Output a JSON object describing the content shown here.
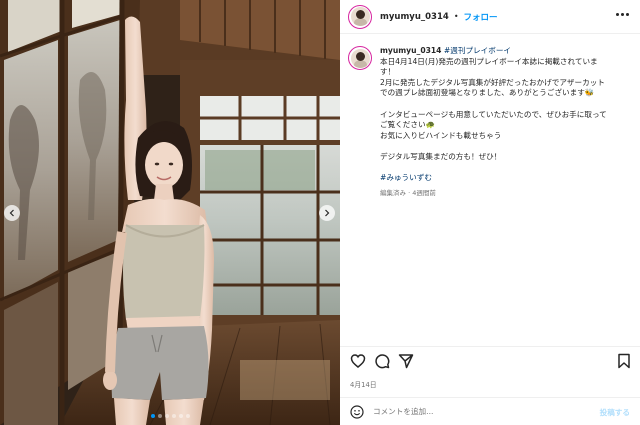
{
  "post": {
    "username": "myumyu_0314",
    "separator": "•",
    "follow_label": "フォロー",
    "photo_count": 6,
    "active_photo": 1
  },
  "caption": {
    "username": "myumyu_0314",
    "tag": "#週刊プレイボーイ",
    "lines": [
      "本日4月14日(月)発売の週刊プレイボーイ本誌に掲載されていま",
      "す！",
      "2月に発売したデジタル写真集が好評だったおかげでアザーカット",
      "での週プレ誌面初登場となりました、ありがとうございます🐝"
    ],
    "lines2": [
      "インタビューページも用意していただいたので、ぜひお手に取って",
      "ご覧ください🐢",
      "お気に入りビハインドも載せちゃう"
    ],
    "line3": "デジタル写真集まだの方も！ぜひ！",
    "hashtag": "#みゅういずむ",
    "meta": "編集済み · 4週間前"
  },
  "actions": {
    "like_icon": "heart-icon",
    "comment_icon": "comment-icon",
    "share_icon": "share-icon",
    "save_icon": "bookmark-icon"
  },
  "date": "4月14日",
  "comment": {
    "placeholder": "コメントを追加...",
    "post_label": "投稿する"
  },
  "colors": {
    "link": "#0095f6",
    "hashtag": "#00376b",
    "muted": "#737373",
    "post_disabled": "#b2dffc"
  }
}
